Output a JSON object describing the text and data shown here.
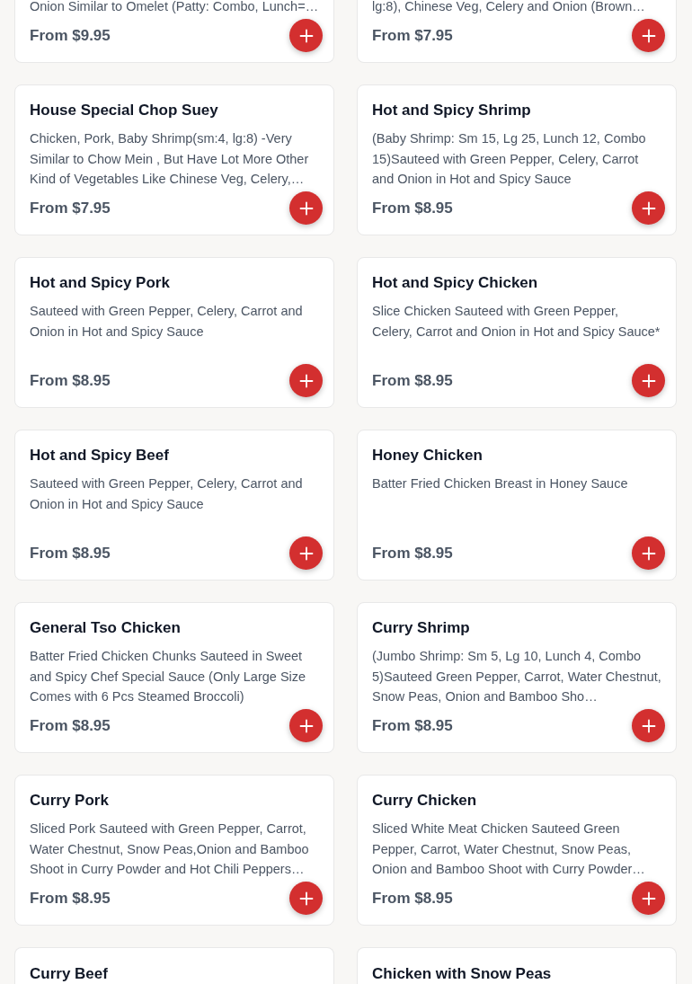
{
  "items": [
    {
      "kind": "cut_top",
      "description": "Onion Similar to Omelet (Patty: Combo, Lunch=…",
      "price": "From $9.95"
    },
    {
      "kind": "cut_top",
      "description": "lg:8), Chinese Veg, Celery and Onion (Brown…",
      "price": "From $7.95"
    },
    {
      "kind": "full",
      "title": "House Special Chop Suey",
      "description": "Chicken, Pork, Baby Shrimp(sm:4, lg:8) -Very Similar to Chow Mein , But Have Lot More Other Kind of Vegetables Like Chinese Veg, Celery,…",
      "price": "From $7.95"
    },
    {
      "kind": "full",
      "title": "Hot and Spicy Shrimp",
      "description": "(Baby Shrimp: Sm 15, Lg 25, Lunch 12, Combo 15)Sauteed with Green Pepper, Celery, Carrot and Onion in Hot and Spicy Sauce",
      "price": "From $8.95"
    },
    {
      "kind": "full",
      "title": "Hot and Spicy Pork",
      "description": "Sauteed with Green Pepper, Celery, Carrot and Onion in Hot and Spicy Sauce",
      "price": "From $8.95"
    },
    {
      "kind": "full",
      "title": "Hot and Spicy Chicken",
      "description": "Slice Chicken Sauteed with Green Pepper, Celery, Carrot and Onion in Hot and Spicy Sauce*",
      "price": "From $8.95"
    },
    {
      "kind": "full",
      "title": "Hot and Spicy Beef",
      "description": "Sauteed with Green Pepper, Celery, Carrot and Onion in Hot and Spicy Sauce",
      "price": "From $8.95"
    },
    {
      "kind": "full",
      "title": "Honey Chicken",
      "description": "Batter Fried Chicken Breast in Honey Sauce",
      "price": "From $8.95"
    },
    {
      "kind": "full",
      "title": "General Tso Chicken",
      "description": "Batter Fried Chicken Chunks Sauteed in Sweet and Spicy Chef Special Sauce (Only Large Size Comes with 6 Pcs Steamed Broccoli)",
      "price": "From $8.95"
    },
    {
      "kind": "full",
      "title": "Curry Shrimp",
      "description": "(Jumbo Shrimp: Sm 5, Lg 10, Lunch 4, Combo 5)Sauteed Green Pepper, Carrot, Water Chestnut, Snow Peas, Onion and Bamboo Sho…",
      "price": "From $8.95"
    },
    {
      "kind": "full",
      "title": "Curry Pork",
      "description": "Sliced Pork Sauteed with Green Pepper, Carrot, Water Chestnut, Snow Peas,Onion and Bamboo Shoot in Curry Powder and Hot Chili Peppers…",
      "price": "From $8.95"
    },
    {
      "kind": "full",
      "title": "Curry Chicken",
      "description": "Sliced White Meat Chicken Sauteed Green Pepper, Carrot, Water Chestnut, Snow Peas, Onion and Bamboo Shoot with Curry Powder…",
      "price": "From $8.95"
    },
    {
      "kind": "cut_bottom",
      "title": "Curry Beef"
    },
    {
      "kind": "cut_bottom",
      "title": "Chicken with Snow Peas"
    }
  ]
}
